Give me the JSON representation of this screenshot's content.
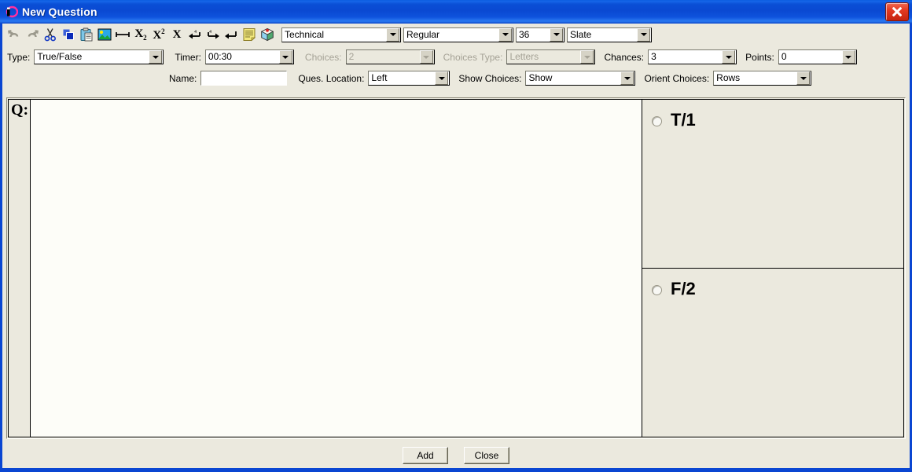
{
  "window": {
    "title": "New Question",
    "icon": "app-icon",
    "close_label": "X",
    "accent_blue": "#0a46d2",
    "face_beige": "#ebe9de",
    "canvas_white": "#fdfdf8"
  },
  "toolbar": {
    "buttons": [
      {
        "name": "undo-icon",
        "tip": "Undo",
        "disabled": true
      },
      {
        "name": "redo-icon",
        "tip": "Redo",
        "disabled": true
      },
      {
        "name": "cut-icon",
        "tip": "Cut",
        "disabled": false
      },
      {
        "name": "copy-icon",
        "tip": "Copy",
        "disabled": false
      },
      {
        "name": "paste-icon",
        "tip": "Paste",
        "disabled": false
      },
      {
        "name": "image-icon",
        "tip": "Insert Image",
        "disabled": false
      },
      {
        "name": "rule-icon",
        "tip": "Insert Rule",
        "disabled": false
      },
      {
        "name": "subscript-icon",
        "tip": "Subscript",
        "disabled": false
      },
      {
        "name": "superscript-icon",
        "tip": "Superscript",
        "disabled": false
      },
      {
        "name": "delete-icon",
        "tip": "Delete",
        "disabled": false
      },
      {
        "name": "indent-left-icon",
        "tip": "Outdent",
        "disabled": false
      },
      {
        "name": "indent-right-icon",
        "tip": "Indent",
        "disabled": false
      },
      {
        "name": "return-icon",
        "tip": "Line Break",
        "disabled": false
      },
      {
        "name": "note-icon",
        "tip": "Note",
        "disabled": false
      },
      {
        "name": "object-icon",
        "tip": "Insert Object",
        "disabled": false
      }
    ],
    "font_family": "Technical",
    "font_style": "Regular",
    "font_size": "36",
    "font_color": "Slate"
  },
  "properties": {
    "type_label": "Type:",
    "type_value": "True/False",
    "timer_label": "Timer:",
    "timer_value": "00:30",
    "choices_label": "Choices:",
    "choices_value": "2",
    "choices_type_label": "Choices Type:",
    "choices_type_value": "Letters",
    "chances_label": "Chances:",
    "chances_value": "3",
    "points_label": "Points:",
    "points_value": "0",
    "name_label": "Name:",
    "name_value": "",
    "name_placeholder": "",
    "ques_location_label": "Ques. Location:",
    "ques_location_value": "Left",
    "show_choices_label": "Show Choices:",
    "show_choices_value": "Show",
    "orient_choices_label": "Orient Choices:",
    "orient_choices_value": "Rows"
  },
  "editor": {
    "question_label": "Q:",
    "question_text": ""
  },
  "choices": [
    {
      "label": "T/1",
      "selected": false
    },
    {
      "label": "F/2",
      "selected": false
    }
  ],
  "footer": {
    "add_label": "Add",
    "close_label": "Close"
  }
}
